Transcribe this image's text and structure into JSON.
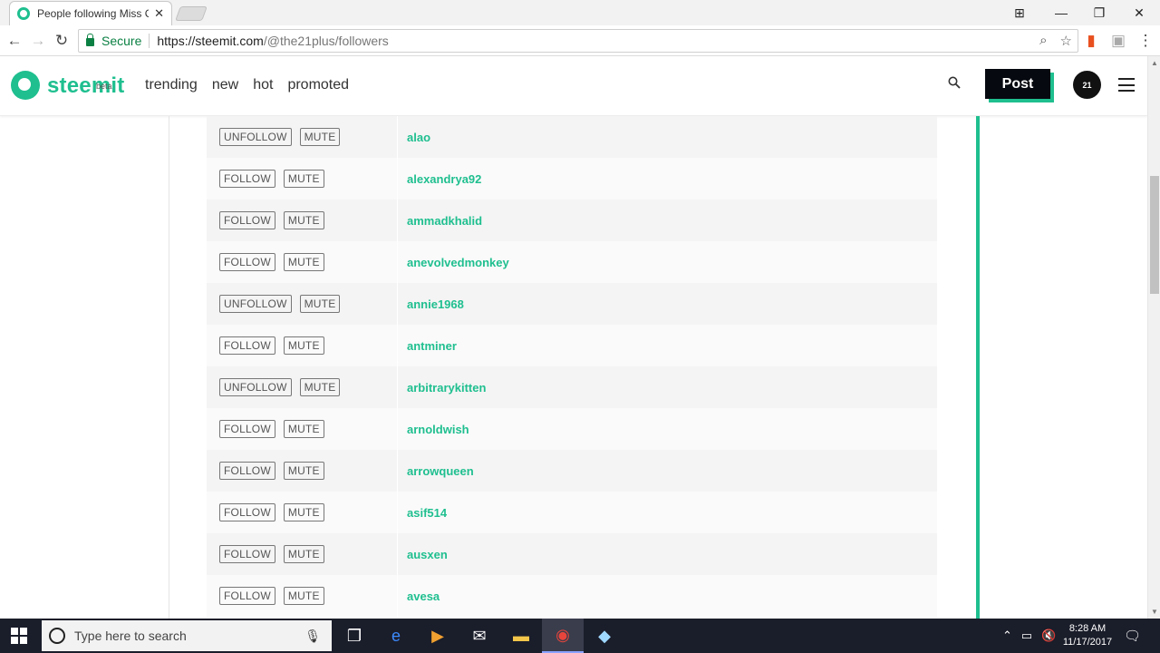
{
  "browser": {
    "tab_title": "People following Miss Ci",
    "tab_close": "✕",
    "secure_label": "Secure",
    "url_host": "https://steemit.com",
    "url_path": "/@the21plus/followers",
    "window_controls": [
      "⊞",
      "—",
      "❐",
      "✕"
    ]
  },
  "site": {
    "logo_text": "steemit",
    "logo_beta": "beta",
    "nav": [
      "trending",
      "new",
      "hot",
      "promoted"
    ],
    "post_label": "Post",
    "avatar_text": "21",
    "accent_color": "#1fbf8f"
  },
  "followers": [
    {
      "name": "alao",
      "action": "UNFOLLOW",
      "mute": "MUTE"
    },
    {
      "name": "alexandrya92",
      "action": "FOLLOW",
      "mute": "MUTE"
    },
    {
      "name": "ammadkhalid",
      "action": "FOLLOW",
      "mute": "MUTE"
    },
    {
      "name": "anevolvedmonkey",
      "action": "FOLLOW",
      "mute": "MUTE"
    },
    {
      "name": "annie1968",
      "action": "UNFOLLOW",
      "mute": "MUTE"
    },
    {
      "name": "antminer",
      "action": "FOLLOW",
      "mute": "MUTE"
    },
    {
      "name": "arbitrarykitten",
      "action": "UNFOLLOW",
      "mute": "MUTE"
    },
    {
      "name": "arnoldwish",
      "action": "FOLLOW",
      "mute": "MUTE"
    },
    {
      "name": "arrowqueen",
      "action": "FOLLOW",
      "mute": "MUTE"
    },
    {
      "name": "asif514",
      "action": "FOLLOW",
      "mute": "MUTE"
    },
    {
      "name": "ausxen",
      "action": "FOLLOW",
      "mute": "MUTE"
    },
    {
      "name": "avesa",
      "action": "FOLLOW",
      "mute": "MUTE"
    }
  ],
  "taskbar": {
    "search_placeholder": "Type here to search",
    "time": "8:28 AM",
    "date": "11/17/2017"
  }
}
